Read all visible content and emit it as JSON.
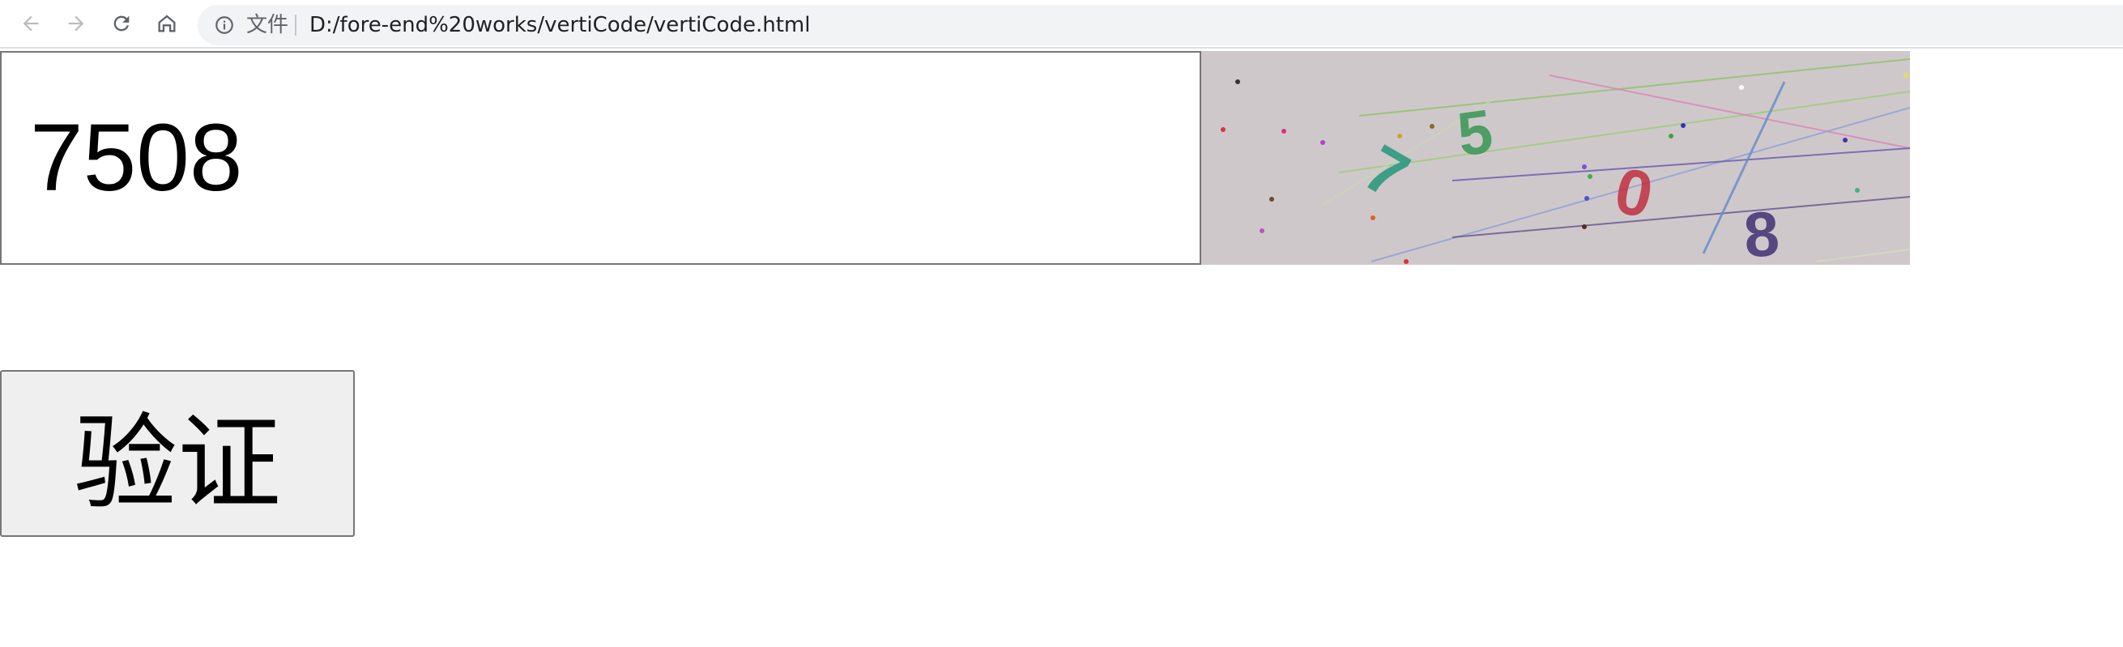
{
  "browser": {
    "scheme_label": "文件",
    "url": "D:/fore-end%20works/vertiCode/vertiCode.html",
    "icons": [
      "back-icon",
      "forward-icon",
      "reload-icon",
      "home-icon",
      "info-icon"
    ]
  },
  "form": {
    "input_value": "7508",
    "verify_label": "验证"
  },
  "captcha": {
    "characters": [
      {
        "char": "7",
        "color": "#2e9a7f",
        "rotate": 30
      },
      {
        "char": "5",
        "color": "#3f9a5a",
        "rotate": -8
      },
      {
        "char": "0",
        "color": "#c0303f",
        "rotate": 12
      },
      {
        "char": "8",
        "color": "#4a3a7a",
        "rotate": -4
      }
    ],
    "background": "#cfc8cb"
  }
}
